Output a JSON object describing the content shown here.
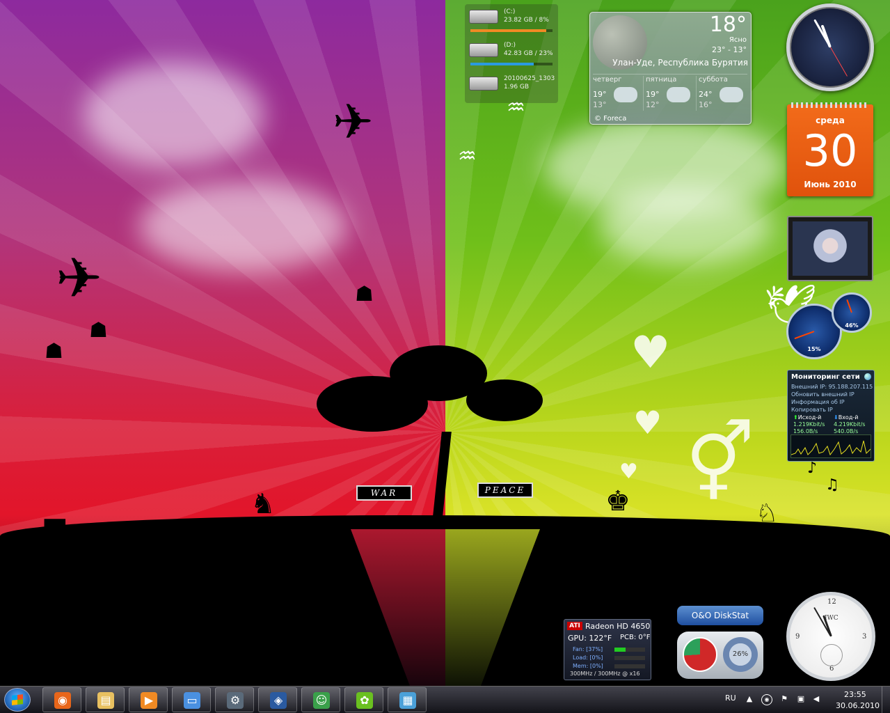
{
  "wallpaper": {
    "sign_left": "WAR",
    "sign_right": "PEACE"
  },
  "drives": [
    {
      "name": "(C:)",
      "info": "23.82 GB / 8%",
      "fill": 0.92,
      "color": "#f08a24"
    },
    {
      "name": "(D:)",
      "info": "42.83 GB / 23%",
      "fill": 0.77,
      "color": "#2a9ae0"
    },
    {
      "name": "20100625_1303",
      "info": "1.96 GB",
      "fill": null,
      "color": null
    }
  ],
  "weather": {
    "temp": "18°",
    "condition": "Ясно",
    "range": "23° - 13°",
    "city": "Улан-Уде, Республика Бурятия",
    "days": [
      {
        "name": "четверг",
        "hi": "19°",
        "lo": "13°",
        "icon": "rain-icon"
      },
      {
        "name": "пятница",
        "hi": "19°",
        "lo": "12°",
        "icon": "rain-icon"
      },
      {
        "name": "суббота",
        "hi": "24°",
        "lo": "16°",
        "icon": "cloud-icon"
      }
    ],
    "credit": "© Foreca"
  },
  "calendar": {
    "weekday": "среда",
    "day": "30",
    "month_year": "Июнь 2010"
  },
  "cpu_meter": {
    "cpu": "15%",
    "memory": "46%"
  },
  "network_monitor": {
    "title": "Мониторинг сети",
    "external_ip_label": "Внешний IP:",
    "external_ip": "95.188.207.115",
    "refresh": "Обновить внешний IP",
    "ip_info": "Информация об IP",
    "copy_ip": "Копировать IP",
    "out_label": "Исход-й",
    "in_label": "Вход-й",
    "out_rate": "1.219Kbit/s",
    "in_rate": "4.219Kbit/s",
    "out_bytes": "156.0B/s",
    "in_bytes": "540.0B/s"
  },
  "ati": {
    "logo": "ATI",
    "gpu_name": "Radeon HD 4650",
    "gpu": "GPU: 122°F",
    "pcb": "PCB: 0°F",
    "fan": "Fan: [37%]",
    "load": "Load: [0%]",
    "mem": "Mem: [0%]",
    "fan_level": 0.37,
    "load_level": 0,
    "mem_level": 0,
    "clocks": "300MHz / 300MHz @ x16"
  },
  "diskstat": {
    "title": "O&O DiskStat",
    "pct": "26%"
  },
  "clock_bottom": {
    "brand": "IWC"
  },
  "taskbar": {
    "apps": [
      {
        "name": "firefox",
        "color": "#e8661a"
      },
      {
        "name": "explorer",
        "color": "#e8c060"
      },
      {
        "name": "media-player",
        "color": "#f08a24"
      },
      {
        "name": "remote-desktop",
        "color": "#4a90e0"
      },
      {
        "name": "steam",
        "color": "#5a6a7a"
      },
      {
        "name": "kmplayer",
        "color": "#2a5aa0"
      },
      {
        "name": "messenger",
        "color": "#3aa04a"
      },
      {
        "name": "icq",
        "color": "#6ac020"
      },
      {
        "name": "control-panel",
        "color": "#4aa0d8"
      }
    ],
    "language": "RU",
    "time": "23:55",
    "date": "30.06.2010"
  }
}
